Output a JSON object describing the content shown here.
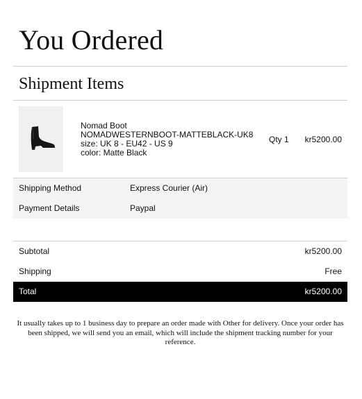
{
  "page": {
    "title": "You Ordered"
  },
  "shipment": {
    "heading": "Shipment Items",
    "item": {
      "name": "Nomad Boot",
      "sku": "NOMADWESTERNBOOT-MATTEBLACK-UK8",
      "size": "size: UK 8 - EU42 - US 9",
      "color": "color: Matte Black",
      "qty": "Qty 1",
      "price": "kr5200.00",
      "image_icon": "boot-image"
    }
  },
  "details": {
    "shipping_method_label": "Shipping Method",
    "shipping_method_value": "Express Courier (Air)",
    "payment_label": "Payment Details",
    "payment_value": "Paypal"
  },
  "totals": {
    "subtotal_label": "Subtotal",
    "subtotal_value": "kr5200.00",
    "shipping_label": "Shipping",
    "shipping_value": "Free",
    "total_label": "Total",
    "total_value": "kr5200.00"
  },
  "footer": {
    "note": "It usually takes up to 1 business day to prepare an order made with Other for delivery. Once your order has been shipped, we will send you an email, which will include the shipment tracking number for your reference."
  }
}
